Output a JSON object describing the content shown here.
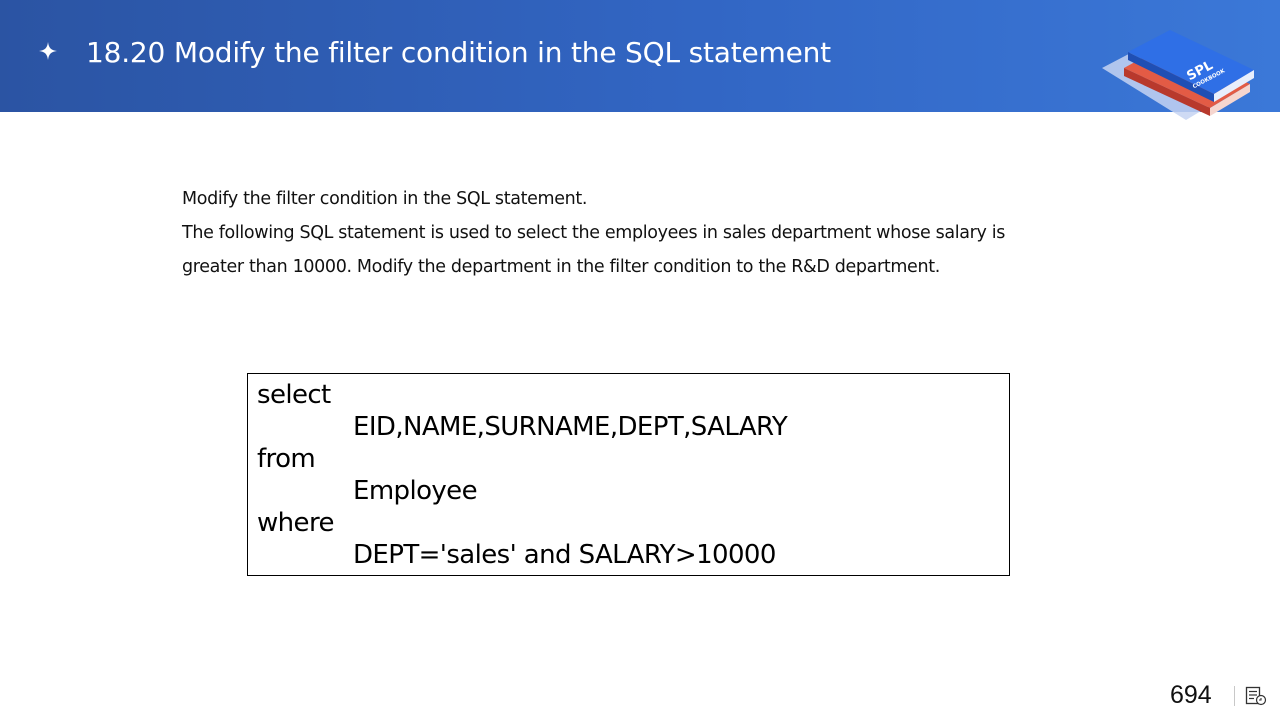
{
  "header": {
    "title": "18.20 Modify the filter condition in the SQL statement",
    "bullet_icon": "four-point-star-icon",
    "logo": {
      "icon": "spl-cookbook-book-stack-icon",
      "text_main": "SPL",
      "text_sub": "COOKBOOK"
    }
  },
  "content": {
    "paragraphs": [
      "Modify the filter condition in the SQL statement.",
      "The following SQL statement is used to select the employees in sales department whose salary is",
      "greater than 10000. Modify the department in the filter condition to the R&D department."
    ]
  },
  "code": {
    "lines": [
      "select",
      "EID,NAME,SURNAME,DEPT,SALARY",
      "from",
      "Employee",
      "where",
      "DEPT='sales' and SALARY>10000"
    ]
  },
  "footer": {
    "page_number": "694",
    "notes_icon": "notes-icon"
  },
  "colors": {
    "header_start": "#2b54a3",
    "header_end": "#3b78d8",
    "book_blue": "#2f6fe6",
    "book_red": "#d24b3a"
  }
}
